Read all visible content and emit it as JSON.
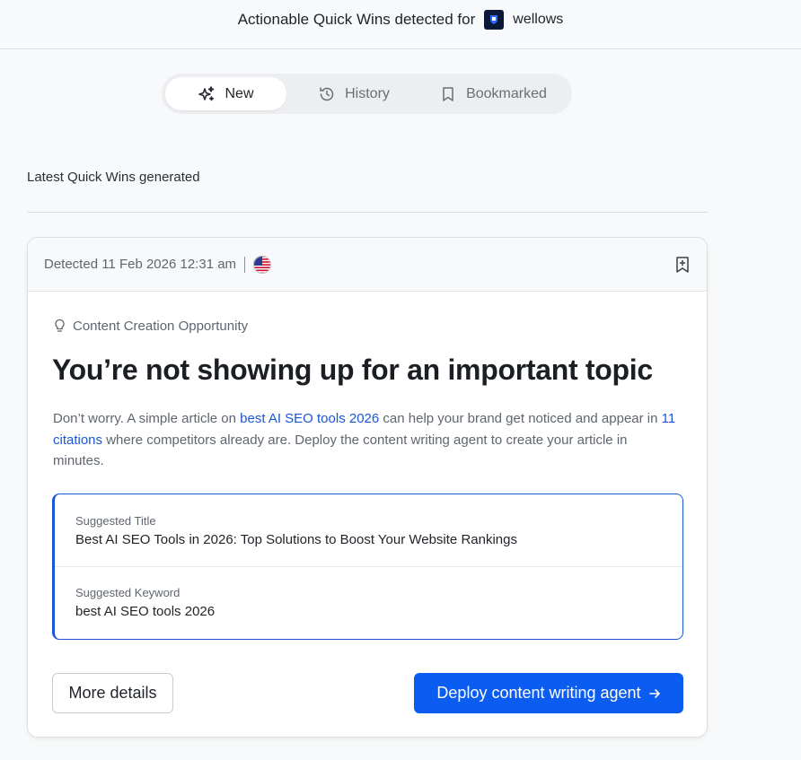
{
  "header": {
    "title": "Actionable Quick Wins detected for",
    "brand_name": "wellows"
  },
  "tabs": [
    {
      "label": "New",
      "icon": "sparkles-icon",
      "active": true
    },
    {
      "label": "History",
      "icon": "history-icon",
      "active": false
    },
    {
      "label": "Bookmarked",
      "icon": "bookmark-icon",
      "active": false
    }
  ],
  "section": {
    "label": "Latest Quick Wins generated"
  },
  "card": {
    "detected": "Detected 11 Feb 2026 12:31 am",
    "country_flag": "us-flag-icon",
    "opportunity_type": "Content Creation Opportunity",
    "headline": "You’re not showing up for an important topic",
    "description": {
      "part1": "Don’t worry. A simple article on ",
      "link1": "best AI SEO tools 2026",
      "part2": " can help your brand get noticed and appear in ",
      "link2": "11 citations",
      "part3": " where competitors already are. Deploy the content writing agent to create your article in minutes."
    },
    "suggested_title_label": "Suggested Title",
    "suggested_title": "Best AI SEO Tools in 2026: Top Solutions to Boost Your Website Rankings",
    "suggested_keyword_label": "Suggested Keyword",
    "suggested_keyword": "best AI SEO tools 2026",
    "more_details_label": "More details",
    "deploy_label": "Deploy content writing agent"
  },
  "colors": {
    "accent": "#0b5cf0",
    "link": "#1a56d6",
    "background": "#f8f9fa"
  }
}
